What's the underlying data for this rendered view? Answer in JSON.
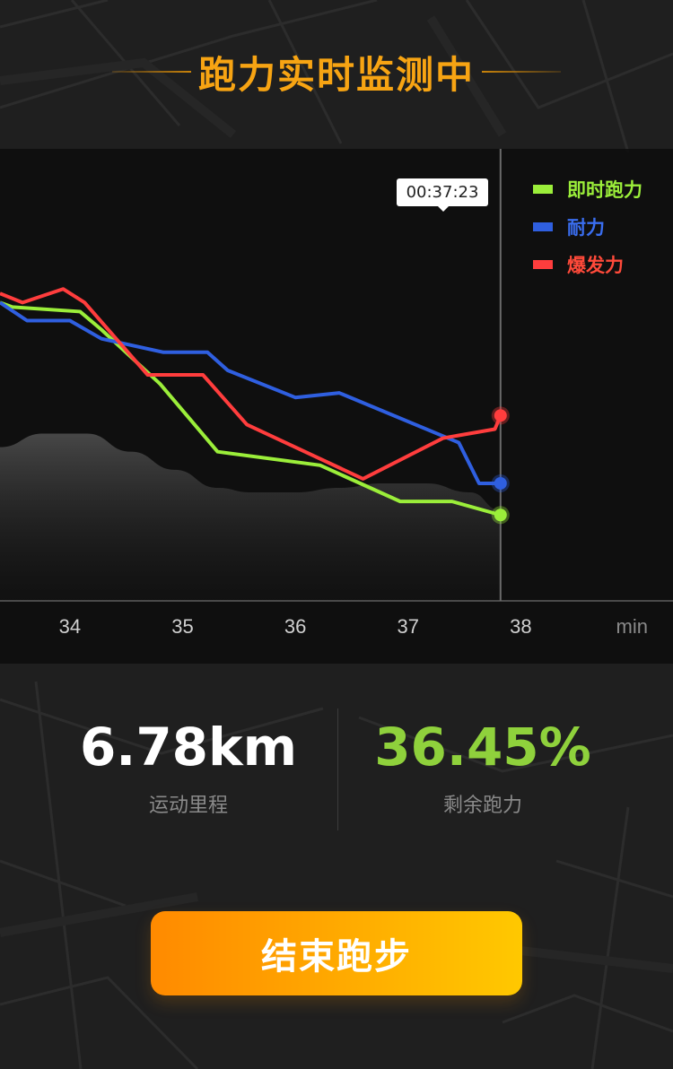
{
  "header": {
    "title": "跑力实时监测中"
  },
  "chart_data": {
    "type": "line",
    "xlabel": "min",
    "x_ticks": [
      "34",
      "35",
      "36",
      "37",
      "38"
    ],
    "xlim": [
      33.38,
      39.35
    ],
    "ylim": [
      0,
      1
    ],
    "cursor": {
      "x": 37.82,
      "label": "00:37:23"
    },
    "series": [
      {
        "name": "即时跑力",
        "color": "#9bee3a",
        "points": [
          [
            33.38,
            0.66
          ],
          [
            33.49,
            0.65
          ],
          [
            34.09,
            0.64
          ],
          [
            34.28,
            0.6
          ],
          [
            34.8,
            0.48
          ],
          [
            35.31,
            0.33
          ],
          [
            36.22,
            0.3
          ],
          [
            36.93,
            0.22
          ],
          [
            37.39,
            0.22
          ],
          [
            37.82,
            0.19
          ]
        ]
      },
      {
        "name": "耐力",
        "color": "#2f5fe0",
        "points": [
          [
            33.38,
            0.66
          ],
          [
            33.62,
            0.62
          ],
          [
            34.0,
            0.62
          ],
          [
            34.28,
            0.58
          ],
          [
            34.83,
            0.55
          ],
          [
            35.22,
            0.55
          ],
          [
            35.4,
            0.51
          ],
          [
            36.0,
            0.45
          ],
          [
            36.39,
            0.46
          ],
          [
            37.45,
            0.35
          ],
          [
            37.63,
            0.26
          ],
          [
            37.82,
            0.26
          ]
        ]
      },
      {
        "name": "爆发力",
        "color": "#ff3d3d",
        "points": [
          [
            33.38,
            0.68
          ],
          [
            33.58,
            0.66
          ],
          [
            33.94,
            0.69
          ],
          [
            34.13,
            0.66
          ],
          [
            34.69,
            0.5
          ],
          [
            35.18,
            0.5
          ],
          [
            35.57,
            0.39
          ],
          [
            36.6,
            0.27
          ],
          [
            37.31,
            0.36
          ],
          [
            37.77,
            0.38
          ],
          [
            37.82,
            0.41
          ]
        ]
      }
    ],
    "background_area": [
      [
        33.38,
        0.34
      ],
      [
        33.76,
        0.37
      ],
      [
        34.15,
        0.37
      ],
      [
        34.54,
        0.33
      ],
      [
        34.93,
        0.29
      ],
      [
        35.31,
        0.25
      ],
      [
        35.6,
        0.24
      ],
      [
        36.0,
        0.24
      ],
      [
        36.39,
        0.25
      ],
      [
        36.77,
        0.26
      ],
      [
        37.16,
        0.26
      ],
      [
        37.55,
        0.24
      ],
      [
        37.82,
        0.2
      ]
    ],
    "grid": false,
    "legend_position": "top-right"
  },
  "stats": {
    "distance": {
      "value": "6.78km",
      "label": "运动里程",
      "color": "#ffffff"
    },
    "remaining": {
      "value": "36.45%",
      "label": "剩余跑力",
      "color": "#8fd13c"
    }
  },
  "button": {
    "label": "结束跑步"
  },
  "colors": {
    "accent": "#f7a413",
    "button_start": "#ff8a00",
    "button_end": "#ffc800"
  }
}
